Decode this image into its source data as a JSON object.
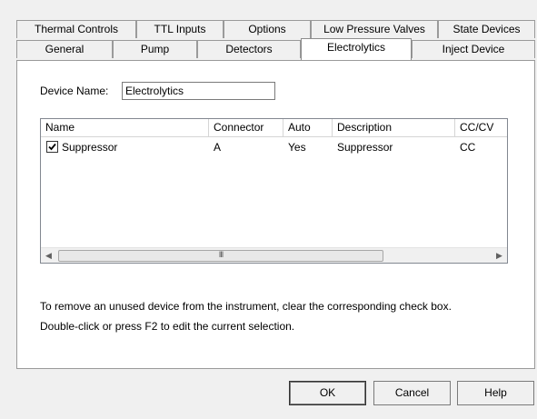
{
  "tabs": {
    "row1": [
      {
        "label": "Thermal Controls"
      },
      {
        "label": "TTL Inputs"
      },
      {
        "label": "Options"
      },
      {
        "label": "Low Pressure Valves"
      },
      {
        "label": "State Devices"
      }
    ],
    "row2": [
      {
        "label": "General"
      },
      {
        "label": "Pump"
      },
      {
        "label": "Detectors"
      },
      {
        "label": "Electrolytics"
      },
      {
        "label": "Inject Device"
      }
    ],
    "active": "Electrolytics"
  },
  "device_name": {
    "label": "Device Name:",
    "value": "Electrolytics"
  },
  "list": {
    "columns": [
      "Name",
      "Connector",
      "Auto",
      "Description",
      "CC/CV"
    ],
    "rows": [
      {
        "checked": true,
        "name": "Suppressor",
        "connector": "A",
        "auto": "Yes",
        "description": "Suppressor",
        "cc_cv": "CC"
      }
    ],
    "scroll_thumb_grip": "III",
    "scroll_left_icon": "chevron-left-icon",
    "scroll_right_icon": "chevron-right-icon"
  },
  "help_text": {
    "line1": "To remove an unused device from the instrument, clear the corresponding check box.",
    "line2": "Double-click or press F2 to edit the current selection."
  },
  "buttons": {
    "ok": "OK",
    "cancel": "Cancel",
    "help": "Help"
  }
}
